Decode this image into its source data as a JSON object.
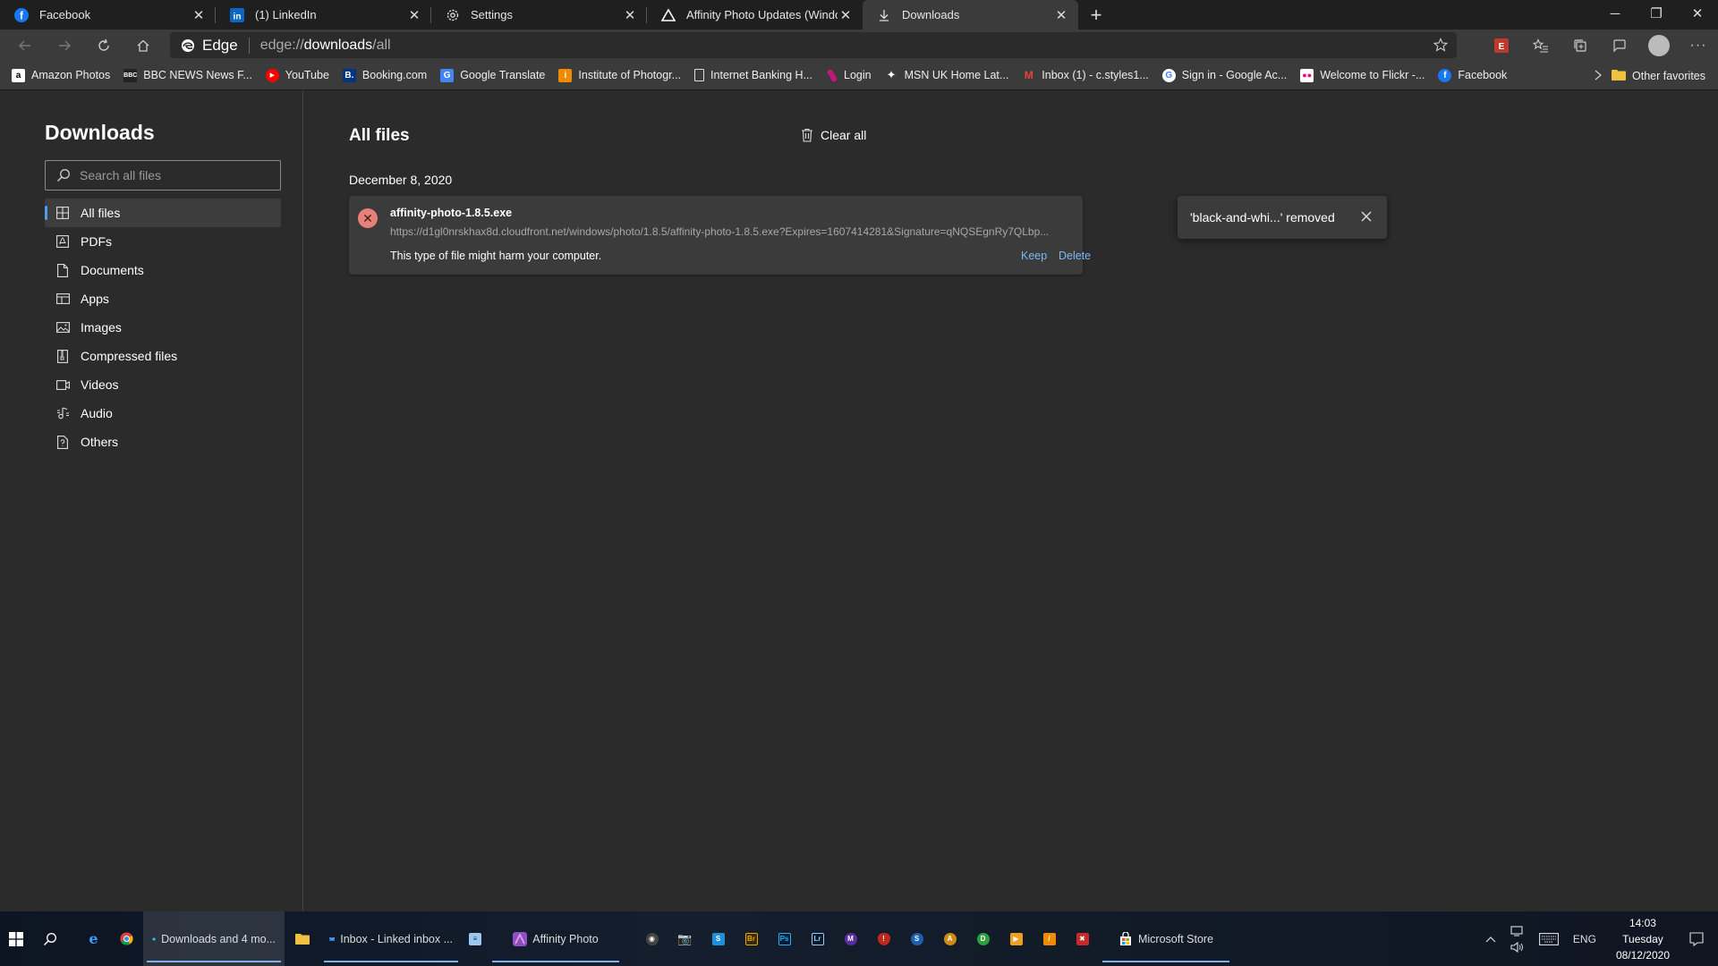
{
  "tabs": [
    {
      "label": "Facebook",
      "icon": "facebook-icon",
      "color": "#1877f2"
    },
    {
      "label": "(1) LinkedIn",
      "icon": "linkedin-icon",
      "color": "#0a66c2"
    },
    {
      "label": "Settings",
      "icon": "gear-icon"
    },
    {
      "label": "Affinity Photo Updates (Window",
      "icon": "affinity-icon"
    },
    {
      "label": "Downloads",
      "icon": "download-icon",
      "active": true
    }
  ],
  "toolbar": {
    "edge_label": "Edge",
    "url_scheme": "edge://",
    "url_host": "downloads",
    "url_path": "/all"
  },
  "favorites": [
    {
      "label": "Amazon Photos",
      "bg": "#ffffff",
      "fg": "#000000",
      "glyph": "a"
    },
    {
      "label": "BBC NEWS News F...",
      "bg": "#222222",
      "fg": "#ffffff",
      "glyph": "B"
    },
    {
      "label": "YouTube",
      "bg": "#ff0000",
      "fg": "#ffffff",
      "glyph": "▶"
    },
    {
      "label": "Booking.com",
      "bg": "#003580",
      "fg": "#ffffff",
      "glyph": "B."
    },
    {
      "label": "Google Translate",
      "bg": "#4285f4",
      "fg": "#ffffff",
      "glyph": "G"
    },
    {
      "label": "Institute of Photogr...",
      "bg": "#f08a00",
      "fg": "#ffffff",
      "glyph": "i"
    },
    {
      "label": "Internet Banking H...",
      "bg": "transparent",
      "fg": "#dddddd",
      "glyph": "▯"
    },
    {
      "label": "Login",
      "bg": "#c0187a",
      "fg": "#ffffff",
      "glyph": "/"
    },
    {
      "label": "MSN UK Home Lat...",
      "bg": "#333333",
      "fg": "#ffffff",
      "glyph": "✦"
    },
    {
      "label": "Inbox (1) - c.styles1...",
      "bg": "#ea4335",
      "fg": "#ffffff",
      "glyph": "M"
    },
    {
      "label": "Sign in - Google Ac...",
      "bg": "#ffffff",
      "fg": "#4285f4",
      "glyph": "G"
    },
    {
      "label": "Welcome to Flickr -...",
      "bg": "#ffffff",
      "fg": "#ff0084",
      "glyph": "••"
    },
    {
      "label": "Facebook",
      "bg": "#1877f2",
      "fg": "#ffffff",
      "glyph": "f"
    }
  ],
  "favorites_other": "Other favorites",
  "sidebar": {
    "title": "Downloads",
    "search_placeholder": "Search all files",
    "items": [
      {
        "label": "All files",
        "icon": "grid-icon",
        "selected": true
      },
      {
        "label": "PDFs",
        "icon": "pdf-icon"
      },
      {
        "label": "Documents",
        "icon": "document-icon"
      },
      {
        "label": "Apps",
        "icon": "apps-icon"
      },
      {
        "label": "Images",
        "icon": "image-icon"
      },
      {
        "label": "Compressed files",
        "icon": "zip-icon"
      },
      {
        "label": "Videos",
        "icon": "video-icon"
      },
      {
        "label": "Audio",
        "icon": "audio-icon"
      },
      {
        "label": "Others",
        "icon": "other-file-icon"
      }
    ]
  },
  "main": {
    "title": "All files",
    "clear_all": "Clear all",
    "date_heading": "December 8, 2020",
    "download": {
      "filename": "affinity-photo-1.8.5.exe",
      "url": "https://d1gl0nrskhax8d.cloudfront.net/windows/photo/1.8.5/affinity-photo-1.8.5.exe?Expires=1607414281&Signature=qNQSEgnRy7QLbp...",
      "warning": "This type of file might harm your computer.",
      "keep_label": "Keep",
      "delete_label": "Delete"
    },
    "toast": "'black-and-whi...' removed"
  },
  "taskbar": {
    "apps": [
      {
        "label": "Downloads and 4 mo...",
        "active": true
      },
      {
        "label": "Inbox - Linked inbox ..."
      },
      {
        "label": "Affinity Photo"
      },
      {
        "label": "Microsoft Store"
      }
    ],
    "tray_lang": "ENG",
    "clock_time": "14:03",
    "clock_day": "Tuesday",
    "clock_date": "08/12/2020"
  },
  "colors": {
    "accent": "#4aa0f0",
    "link": "#7ab8f5",
    "error": "#e8807a"
  }
}
